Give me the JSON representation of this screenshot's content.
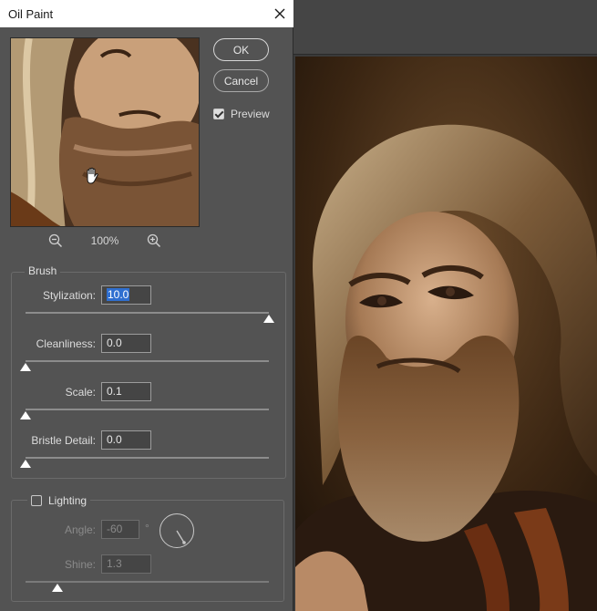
{
  "dialog": {
    "title": "Oil Paint",
    "ok_label": "OK",
    "cancel_label": "Cancel",
    "preview_label": "Preview",
    "preview_checked": true,
    "zoom_level": "100%"
  },
  "brush": {
    "group_title": "Brush",
    "stylization": {
      "label": "Stylization:",
      "value": "10.0",
      "position": 1.0
    },
    "cleanliness": {
      "label": "Cleanliness:",
      "value": "0.0",
      "position": 0.0
    },
    "scale": {
      "label": "Scale:",
      "value": "0.1",
      "position": 0.0
    },
    "bristle_detail": {
      "label": "Bristle Detail:",
      "value": "0.0",
      "position": 0.0
    }
  },
  "lighting": {
    "group_title": "Lighting",
    "enabled": false,
    "angle": {
      "label": "Angle:",
      "value": "-60",
      "unit": "°"
    },
    "shine": {
      "label": "Shine:",
      "value": "1.3",
      "position": 0.13
    }
  },
  "icons": {
    "close": "close-icon",
    "hand": "hand-tool-icon",
    "zoom_out": "zoom-out-icon",
    "zoom_in": "zoom-in-icon"
  },
  "colors": {
    "dialog_bg": "#535353",
    "selection": "#2f6fd0"
  }
}
